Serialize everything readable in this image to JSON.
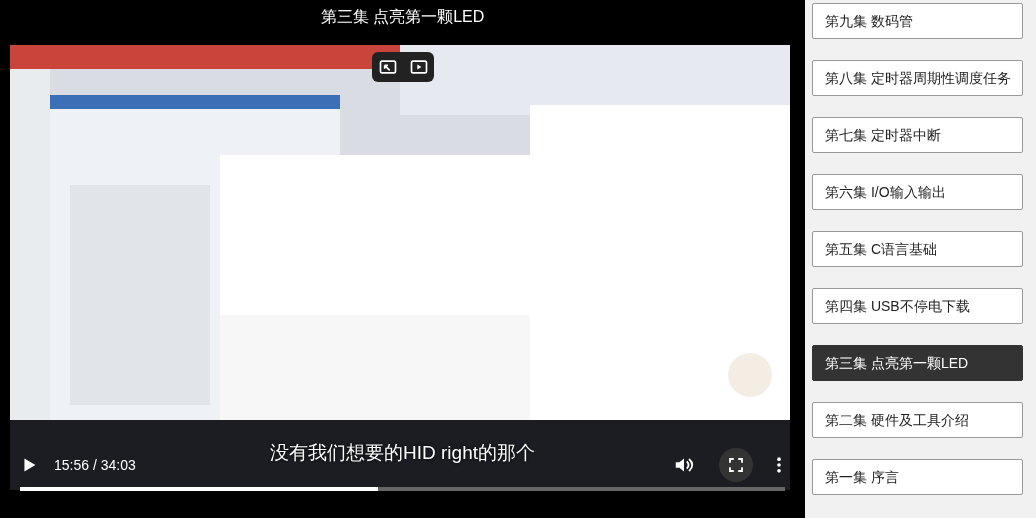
{
  "player": {
    "title": "第三集 点亮第一颗LED",
    "subtitle": "没有我们想要的HID right的那个",
    "time": "15:56 / 34:03",
    "progress": {
      "level": 0.468
    },
    "playing": false
  },
  "episodes": [
    {
      "label": "第九集 数码管",
      "selected": false
    },
    {
      "label": "第八集 定时器周期性调度任务",
      "selected": false
    },
    {
      "label": "第七集 定时器中断",
      "selected": false
    },
    {
      "label": "第六集 I/O输入输出",
      "selected": false
    },
    {
      "label": "第五集 C语言基础",
      "selected": false
    },
    {
      "label": "第四集 USB不停电下载",
      "selected": false
    },
    {
      "label": "第三集 点亮第一颗LED",
      "selected": true
    },
    {
      "label": "第二集 硬件及工具介绍",
      "selected": false
    },
    {
      "label": "第一集 序言",
      "selected": false
    }
  ]
}
